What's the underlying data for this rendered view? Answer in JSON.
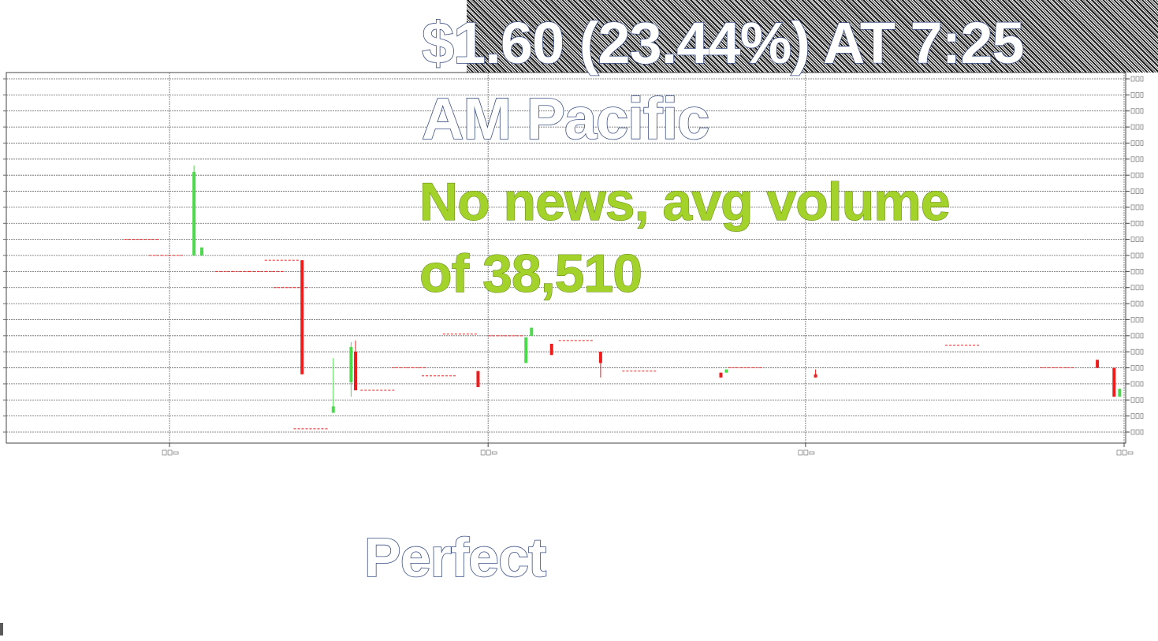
{
  "annotations": {
    "price_line_1": "$1.60 (23.44%) AT 7:25",
    "price_line_2": "AM Pacific",
    "note_line_1": "No news, avg volume",
    "note_line_2": "of 38,510",
    "verdict": "Perfect"
  },
  "colors": {
    "up_candle": "#4cd94c",
    "down_candle": "#ee1c1c",
    "gridline": "#666666",
    "note_text": "#a3d32b",
    "outline_text": "#3c4f84"
  },
  "chart_data": {
    "type": "candlestick",
    "title": "",
    "xlabel": "",
    "ylabel": "",
    "grid": true,
    "y_axis_side": "right",
    "ylim": [
      0,
      22
    ],
    "xlim": [
      0,
      100
    ],
    "x_ticks": [
      {
        "x": 14.3,
        "label": ""
      },
      {
        "x": 42.9,
        "label": ""
      },
      {
        "x": 71.4,
        "label": ""
      },
      {
        "x": 100,
        "label": ""
      }
    ],
    "y_tick_labels_legible": false,
    "candles": [
      {
        "x": 11.8,
        "open": 12.0,
        "high": 12.0,
        "low": 12.0,
        "close": 12.0
      },
      {
        "x": 14.0,
        "open": 11.0,
        "high": 11.0,
        "low": 11.0,
        "close": 11.0
      },
      {
        "x": 16.5,
        "open": 11.0,
        "high": 16.6,
        "low": 11.0,
        "close": 16.2
      },
      {
        "x": 17.2,
        "open": 11.0,
        "high": 11.5,
        "low": 11.0,
        "close": 11.5
      },
      {
        "x": 20.0,
        "open": 10.0,
        "high": 10.0,
        "low": 10.0,
        "close": 10.0
      },
      {
        "x": 23.0,
        "open": 10.0,
        "high": 10.0,
        "low": 10.0,
        "close": 10.0
      },
      {
        "x": 24.4,
        "open": 10.7,
        "high": 10.7,
        "low": 10.7,
        "close": 10.7
      },
      {
        "x": 25.2,
        "open": 9.0,
        "high": 9.0,
        "low": 9.0,
        "close": 9.0
      },
      {
        "x": 26.2,
        "open": 10.7,
        "high": 10.7,
        "low": 3.6,
        "close": 3.6
      },
      {
        "x": 27.0,
        "open": 0.2,
        "high": 0.2,
        "low": 0.2,
        "close": 0.2
      },
      {
        "x": 29.0,
        "open": 1.2,
        "high": 4.6,
        "low": 1.2,
        "close": 1.6
      },
      {
        "x": 30.6,
        "open": 3.1,
        "high": 5.6,
        "low": 2.2,
        "close": 5.3
      },
      {
        "x": 31.0,
        "open": 5.0,
        "high": 5.7,
        "low": 2.6,
        "close": 2.6
      },
      {
        "x": 33.0,
        "open": 2.6,
        "high": 2.6,
        "low": 2.6,
        "close": 2.6
      },
      {
        "x": 35.8,
        "open": 4.0,
        "high": 4.0,
        "low": 4.0,
        "close": 4.0
      },
      {
        "x": 38.5,
        "open": 3.5,
        "high": 3.5,
        "low": 3.5,
        "close": 3.5
      },
      {
        "x": 40.4,
        "open": 6.1,
        "high": 6.1,
        "low": 6.1,
        "close": 6.1
      },
      {
        "x": 42.0,
        "open": 3.8,
        "high": 3.8,
        "low": 2.8,
        "close": 2.8
      },
      {
        "x": 44.5,
        "open": 6.0,
        "high": 6.0,
        "low": 6.0,
        "close": 6.0
      },
      {
        "x": 46.3,
        "open": 4.3,
        "high": 5.9,
        "low": 4.3,
        "close": 5.9
      },
      {
        "x": 46.8,
        "open": 6.0,
        "high": 6.5,
        "low": 6.0,
        "close": 6.5
      },
      {
        "x": 48.6,
        "open": 5.5,
        "high": 5.5,
        "low": 4.8,
        "close": 4.8
      },
      {
        "x": 50.8,
        "open": 5.7,
        "high": 5.7,
        "low": 5.7,
        "close": 5.7
      },
      {
        "x": 53.0,
        "open": 5.0,
        "high": 5.0,
        "low": 3.4,
        "close": 4.3
      },
      {
        "x": 56.5,
        "open": 3.8,
        "high": 3.8,
        "low": 3.8,
        "close": 3.8
      },
      {
        "x": 63.8,
        "open": 3.7,
        "high": 3.7,
        "low": 3.4,
        "close": 3.4
      },
      {
        "x": 64.3,
        "open": 3.7,
        "high": 3.9,
        "low": 3.7,
        "close": 3.9
      },
      {
        "x": 66.0,
        "open": 4.0,
        "high": 4.0,
        "low": 4.0,
        "close": 4.0
      },
      {
        "x": 72.3,
        "open": 3.6,
        "high": 3.9,
        "low": 3.4,
        "close": 3.4
      },
      {
        "x": 85.5,
        "open": 5.4,
        "high": 5.4,
        "low": 5.4,
        "close": 5.4
      },
      {
        "x": 94.0,
        "open": 4.0,
        "high": 4.0,
        "low": 4.0,
        "close": 4.0
      },
      {
        "x": 97.6,
        "open": 4.5,
        "high": 4.5,
        "low": 4.0,
        "close": 4.0
      },
      {
        "x": 99.1,
        "open": 4.0,
        "high": 4.0,
        "low": 2.2,
        "close": 2.2
      },
      {
        "x": 99.6,
        "open": 2.2,
        "high": 2.7,
        "low": 2.2,
        "close": 2.7
      }
    ]
  }
}
